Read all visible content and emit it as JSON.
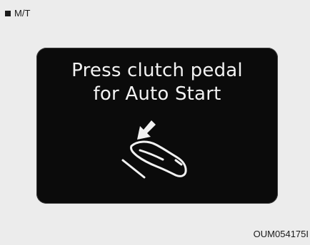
{
  "header": {
    "label": "M/T",
    "bullet_icon": "square-bullet-icon"
  },
  "display": {
    "line1": "Press clutch pedal",
    "line2": "for Auto Start",
    "icon": "clutch-pedal-press-icon"
  },
  "figure_id": "OUM054175I",
  "colors": {
    "background": "#ececec",
    "panel": "#0b0b0b",
    "text": "#f2f2f2"
  }
}
